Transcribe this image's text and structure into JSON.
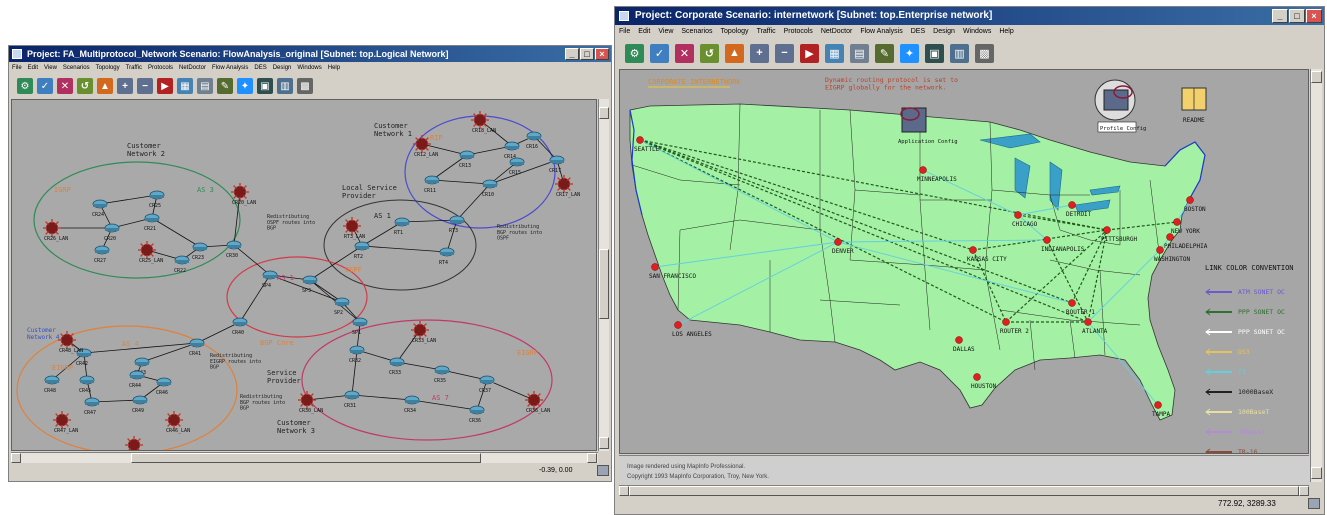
{
  "left_window": {
    "title": "Project: FA_Multiprotocol_Network Scenario: FlowAnalysis_original [Subnet: top.Logical Network]",
    "menus": [
      "File",
      "Edit",
      "View",
      "Scenarios",
      "Topology",
      "Traffic",
      "Protocols",
      "NetDoctor",
      "Flow Analysis",
      "DES",
      "Design",
      "Windows",
      "Help"
    ],
    "status_text": "-0.39, 0.00",
    "groups": [
      {
        "label": "Customer\nNetwork 2",
        "proto": "IGRP",
        "as": "AS 3"
      },
      {
        "label": "Customer\nNetwork 1",
        "proto": "RIP"
      },
      {
        "label": "Local Service\nProvider",
        "proto": "OSPF",
        "as": "AS 1"
      },
      {
        "label": "Customer\nNetwork 4",
        "proto": "EIGRP",
        "as": "AS 4"
      },
      {
        "label": "Service\nProvider",
        "proto": "BGP Core",
        "as": "AS 1"
      },
      {
        "label": "Customer\nNetwork 3",
        "proto": "EIGRP",
        "as": "AS 7"
      }
    ],
    "nodes": [
      "CR18_LAN",
      "CR12_LAN",
      "CR13",
      "CR14",
      "CR15",
      "CR16",
      "CR17",
      "CR11",
      "CR10",
      "CR17_LAN",
      "CR24",
      "CR25",
      "CR26_LAN",
      "CR20",
      "CR27",
      "CR21",
      "CR23",
      "CR22",
      "CR25_LAN",
      "CR20_LAN",
      "CR30",
      "RT3_LAN",
      "RT1",
      "RT2",
      "RT3",
      "RT4",
      "SP4",
      "SP3",
      "SP2",
      "SP1",
      "CR40",
      "CR41",
      "CR42",
      "CR43",
      "CR44",
      "CR45",
      "CR46",
      "CR47",
      "CR48",
      "CR49",
      "CR48_LAN",
      "CR47_LAN",
      "CR46_LAN",
      "CR40_LAN",
      "CR32",
      "CR33",
      "CR33_LAN",
      "CR31",
      "CR34",
      "CR35",
      "CR36",
      "CR37",
      "CR36_LAN",
      "CR30_LAN"
    ],
    "annotations": [
      "Redistributing\nOSPF routes into\nBGP",
      "Redistributing\nBGP routes into\nOSPF",
      "Redistributing\nEIGRP routes into\nBGP",
      "Redistributing\nBGP routes into\nBGP"
    ]
  },
  "right_window": {
    "title": "Project: Corporate Scenario: internetwork [Subnet: top.Enterprise network]",
    "menus": [
      "File",
      "Edit",
      "View",
      "Scenarios",
      "Topology",
      "Traffic",
      "Protocols",
      "NetDoctor",
      "Flow Analysis",
      "DES",
      "Design",
      "Windows",
      "Help"
    ],
    "map_title": "CORPORATE INTERNETWORK",
    "map_note": "Dynamic routing protocol is set to\nEIGRP globally for the network.",
    "app_config": "Application Config",
    "profile_config": "Profile Config",
    "readme": "README",
    "cities": [
      "SEATTLE",
      "MINNEAPOLIS",
      "CHICAGO",
      "DETROIT",
      "BOSTON",
      "NEW YORK",
      "PHILADELPHIA",
      "WASHINGTON",
      "PITTSBURGH",
      "INDIANAPOLIS",
      "KANSAS CITY",
      "DENVER",
      "SAN FRANCISCO",
      "LOS ANGELES",
      "DALLAS",
      "HOUSTON",
      "ROUTER 2",
      "ROUTER 1",
      "ATLANTA",
      "TAMPA"
    ],
    "legend_title": "LINK COLOR CONVENTION",
    "legend": [
      {
        "label": "ATM SONET OC",
        "color": "#6a5acd"
      },
      {
        "label": "PPP SONET OC",
        "color": "#2f6f2f"
      },
      {
        "label": "PPP SONET OC",
        "color": "#ffffff"
      },
      {
        "label": "DS3",
        "color": "#e6c05a"
      },
      {
        "label": "T1",
        "color": "#5fd0e0"
      },
      {
        "label": "1000BaseX",
        "color": "#222222"
      },
      {
        "label": "100BaseT",
        "color": "#e8e0a0"
      },
      {
        "label": "10BaseT",
        "color": "#b28ad6"
      },
      {
        "label": "TR-16",
        "color": "#8b4a3a"
      }
    ],
    "console_lines": [
      "Image rendered using MapInfo Professional.",
      "Copyright 1993 MapInfo Corporation, Troy, New York."
    ],
    "status_text": "772.92, 3289.33"
  }
}
